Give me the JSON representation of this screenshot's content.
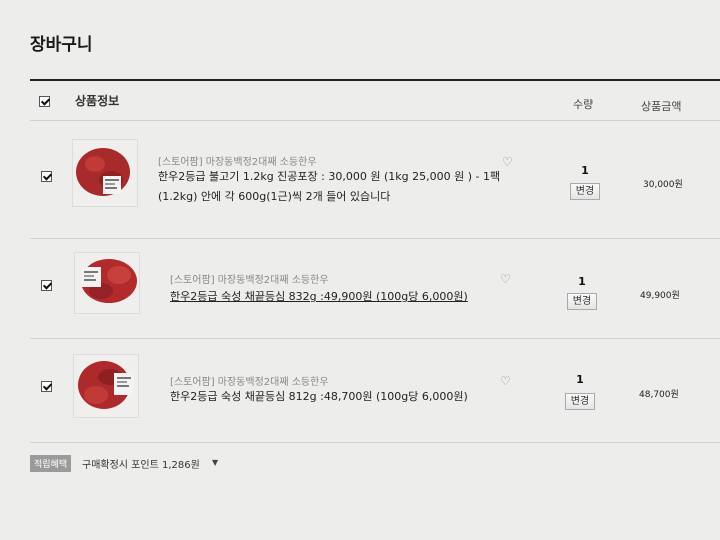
{
  "page": {
    "title": "장바구니"
  },
  "header": {
    "product_info": "상품정보",
    "quantity": "수량",
    "amount": "상품금액"
  },
  "items": [
    {
      "seller": "[스토어팜] 마장동백정2대째 소등한우",
      "name": "한우2등급 불고기 1.2kg 진공포장 : 30,000 원 (1kg 25,000 원 ) - 1팩(1.2kg) 안에 각 600g(1근)씩 2개 들어 있습니다",
      "quantity": "1",
      "change_label": "변경",
      "price": "30,000원",
      "checked": true
    },
    {
      "seller": "[스토어팜] 마장동백정2대째 소등한우",
      "name": "한우2등급 숙성 채끝등심 832g :49,900원 (100g당 6,000원)",
      "quantity": "1",
      "change_label": "변경",
      "price": "49,900원",
      "checked": true
    },
    {
      "seller": "[스토어팜] 마장동백정2대째 소등한우",
      "name": "한우2등급 숙성 채끝등심 812g :48,700원 (100g당 6,000원)",
      "quantity": "1",
      "change_label": "변경",
      "price": "48,700원",
      "checked": true
    }
  ],
  "footer": {
    "badge": "적립혜택",
    "points_text": "구매확정시 포인트 1,286원"
  },
  "icons": {
    "heart": "heart-icon",
    "dropdown": "caret-down-icon"
  },
  "colors": {
    "background": "#ededeb",
    "text": "#2a2a2a",
    "meat": "#b5262a"
  }
}
